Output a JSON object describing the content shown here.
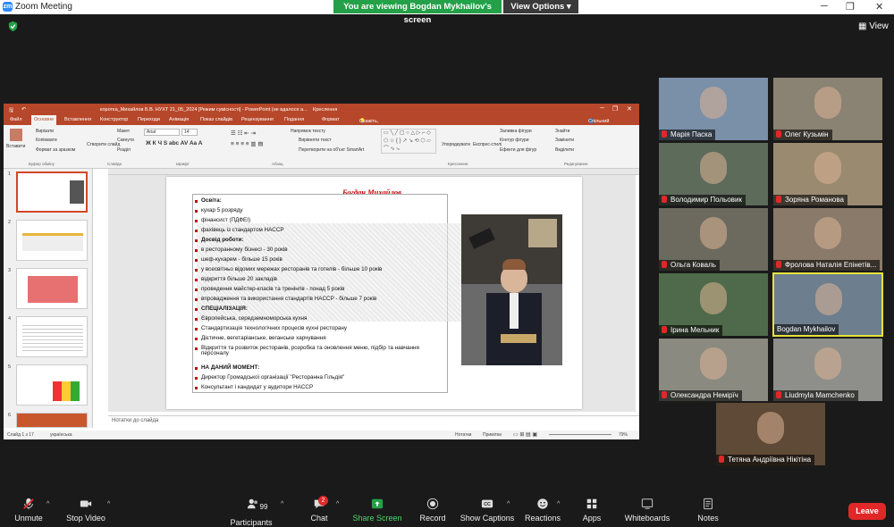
{
  "titlebar": {
    "app": "Zoom",
    "title": "Zoom Meeting"
  },
  "share": {
    "viewing": "You are viewing Bogdan Mykhailov's screen",
    "view_options": "View Options"
  },
  "view": "View",
  "ppt": {
    "title": "коротка_Михайлов Б.В. НУХТ 21_05_2024 [Режим сумісності] - PowerPoint (не вдалося а...",
    "tools": "Засоби креслення",
    "tabs": [
      "Файл",
      "Основне",
      "Вставлення",
      "Конструктор",
      "Переходи",
      "Анімація",
      "Показ слайдів",
      "Рецензування",
      "Подання",
      "Формат"
    ],
    "tell": "Скажіть, що потрібно зробити...",
    "share": "Спільний доступ",
    "ribbon": {
      "paste": "Вставити",
      "cut": "Вирізати",
      "copy": "Копіювати",
      "format": "Формат за зразком",
      "new": "Створити слайд",
      "layout": "Макет",
      "reset": "Скинути",
      "section": "Розділ",
      "font": "Arial",
      "size": "14",
      "dir": "Напрямок тексту",
      "align": "Вирівняти текст",
      "smart": "Перетворити на об'єкт SmartArt",
      "arrange": "Упорядкувати",
      "styles": "Експрес-стилі",
      "fill": "Заливка фігури",
      "outline": "Контур фігури",
      "effects": "Ефекти для фігур",
      "find": "Знайти",
      "replace": "Замінити",
      "select": "Виділити",
      "g_clip": "Буфер обміну",
      "g_slides": "Слайди",
      "g_font": "Шрифт",
      "g_para": "Абзац",
      "g_draw": "Креслення",
      "g_edit": "Редагування"
    },
    "slide": {
      "name": "Богдан Михайлов",
      "lines": [
        {
          "t": "Освіта:",
          "b": true
        },
        {
          "t": "кухар 5 розряду",
          "b": false
        },
        {
          "t": "фінансист (ПДФЕІ)",
          "b": false
        },
        {
          "t": "фахівець із стандартом HACCP",
          "b": false
        },
        {
          "t": "Досвід роботи:",
          "b": true
        },
        {
          "t": "в ресторанному бізнесі - 30 років",
          "b": false
        },
        {
          "t": "шеф-кухарем - більше 15 років",
          "b": false
        },
        {
          "t": "у всесвітньо відомих мережах ресторанів та готелів - більше 10 років",
          "b": false
        },
        {
          "t": "відкриття більше 20 закладів",
          "b": false
        },
        {
          "t": "проведення майстер-класів та тренінгів - понад 5 років",
          "b": false
        },
        {
          "t": "впровадження та використання стандартів HACCP - більше 7 років",
          "b": false
        },
        {
          "t": "СПЕЦІАЛІЗАЦІЯ:",
          "b": true
        },
        {
          "t": "Європейська, середземноморська кухня",
          "b": false
        },
        {
          "t": "Стандартизація технологічних процесів кухні ресторану",
          "b": false
        },
        {
          "t": "Дієтичне, вегетаріанське, веганське харчування",
          "b": false
        },
        {
          "t": "Відкриття та розвиток ресторанів, розробка та оновлення меню, підбір та навчання",
          "b": false
        },
        {
          "t": "персоналу",
          "b": false
        },
        {
          "t": "НА ДАНИЙ МОМЕНТ:",
          "b": true
        },
        {
          "t": "Директор Громадської організації \"Ресторанна Гільдія\"",
          "b": false
        },
        {
          "t": "Консультант і кандидат у аудитори  HACCP",
          "b": false
        }
      ]
    },
    "thumb_nums": [
      "1",
      "2",
      "3",
      "4",
      "5",
      "6"
    ],
    "notes": "Нотатки до слайда",
    "status": {
      "slide": "Слайд 1 з 17",
      "lang": "українська",
      "notes": "Нотатки",
      "comments": "Примітки",
      "zoom": "79%"
    }
  },
  "participants": [
    {
      "name": "Марія Паска",
      "bg": "#7a8fa8"
    },
    {
      "name": "Олег Кузьмін",
      "bg": "#8a8272"
    },
    {
      "name": "Володимир Польовик",
      "bg": "#5c6b5a"
    },
    {
      "name": "Зоряна Романова",
      "bg": "#9a8a70"
    },
    {
      "name": "Ольга Коваль",
      "bg": "#6c6a5e"
    },
    {
      "name": "Фролова Наталія Епінетів...",
      "bg": "#8a7a6a"
    },
    {
      "name": "Ірина Мельник",
      "bg": "#4f6a4a"
    },
    {
      "name": "Bogdan Mykhailov",
      "bg": "#6d7e8e"
    },
    {
      "name": "Олександра Немірїч",
      "bg": "#8a8a80"
    },
    {
      "name": "Liudmyla Mamchenko",
      "bg": "#8e8e8a"
    },
    {
      "name": "Тетяна Андріївна Нікітіна",
      "bg": "#5e4a36"
    }
  ],
  "toolbar": {
    "mute": "Unmute",
    "video": "Stop Video",
    "participants": "Participants",
    "count": "99",
    "chat": "Chat",
    "chat_badge": "2",
    "share": "Share Screen",
    "record": "Record",
    "captions": "Show Captions",
    "reactions": "Reactions",
    "apps": "Apps",
    "whiteboards": "Whiteboards",
    "notes": "Notes",
    "leave": "Leave"
  }
}
